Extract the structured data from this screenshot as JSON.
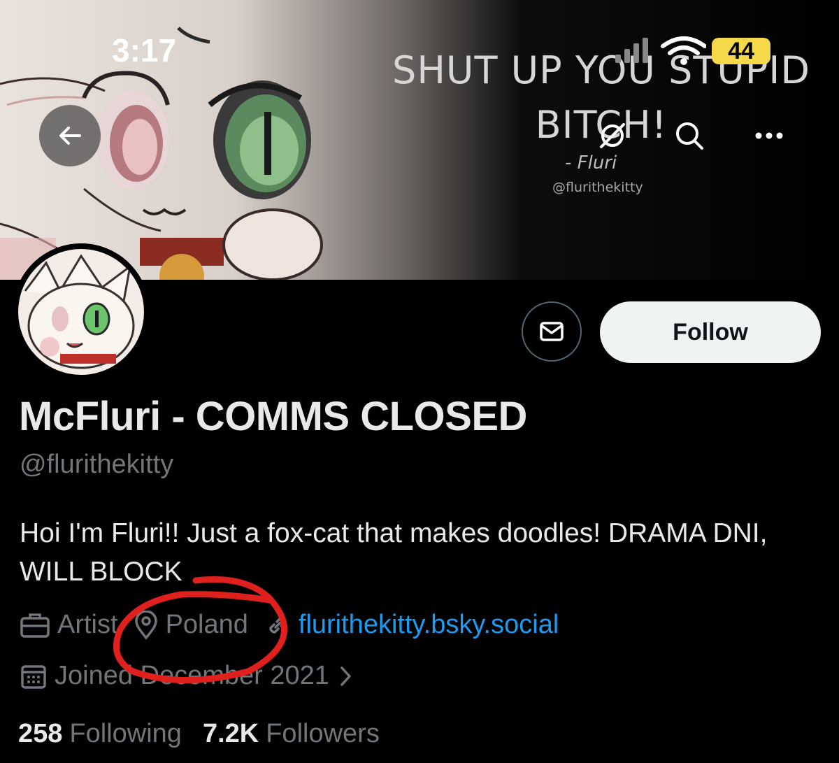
{
  "status_bar": {
    "time": "3:17",
    "battery": "44",
    "icons": [
      "signal-icon",
      "wifi-icon",
      "battery-icon"
    ]
  },
  "banner": {
    "quote": "SHUT UP YOU STUPID BITCH!",
    "attribution": "- Fluri",
    "handle": "@flurithekitty"
  },
  "nav": {
    "back_icon": "arrow-left-icon",
    "grok_icon": "slash-circle-icon",
    "search_icon": "search-icon",
    "more_icon": "more-icon"
  },
  "actions": {
    "message_icon": "envelope-icon",
    "follow_label": "Follow"
  },
  "profile": {
    "display_name": "McFluri - COMMS CLOSED",
    "handle": "@flurithekitty",
    "bio": "Hoi I'm Fluri!! Just a fox-cat that makes doodles! DRAMA DNI, WILL BLOCK",
    "category": "Artist",
    "location": "Poland",
    "link": "flurithekitty.bsky.social",
    "joined": "Joined December 2021"
  },
  "stats": {
    "following_count": "258",
    "following_label": "Following",
    "followers_count": "7.2K",
    "followers_label": "Followers"
  },
  "colors": {
    "background": "#000000",
    "text_primary": "#e7e9ea",
    "text_secondary": "#71767b",
    "link": "#1d9bf0",
    "follow_bg": "#eff3f4",
    "annotation": "#e0201c",
    "battery": "#f5d94a"
  }
}
